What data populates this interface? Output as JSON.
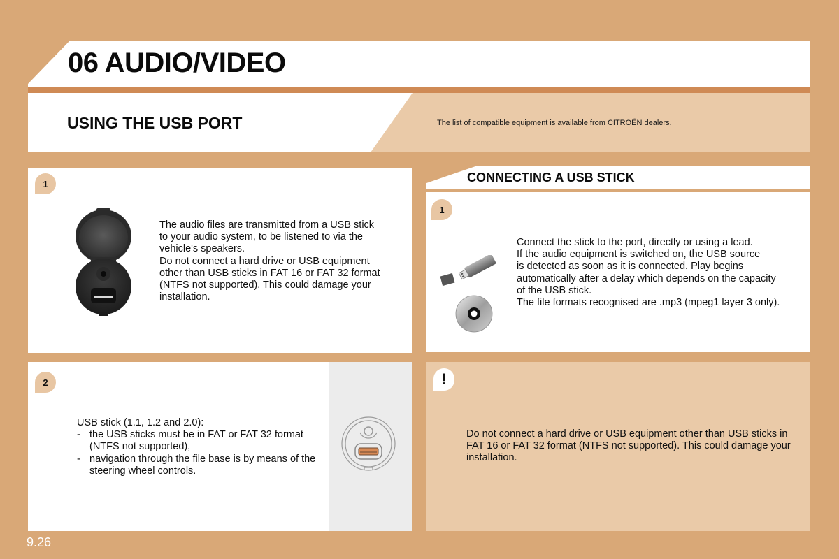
{
  "header": {
    "title": "06 AUDIO/VIDEO",
    "subtitle": "USING THE USB PORT",
    "note": "The list of compatible equipment is available from CITROËN dealers."
  },
  "colors": {
    "background": "#d9a877",
    "accent_rule": "#cf8a55",
    "panel_tint": "#eacaa8",
    "badge": "#e8c6a3"
  },
  "panels": {
    "port_info": {
      "badge": "1",
      "text": "The audio files are transmitted from a USB stick\nto your audio system, to be listened to via the\nvehicle's speakers.\nDo not connect a hard drive or USB equipment\nother than USB sticks in FAT 16 or FAT 32 format\n(NTFS not supported). This could damage your\ninstallation.",
      "illustration": "usb-socket-icon"
    },
    "stick_requirements": {
      "badge": "2",
      "intro": "USB stick (1.1, 1.2 and 2.0):",
      "items": [
        {
          "dash": "-",
          "text": "the USB sticks must be in FAT or FAT 32 format (NTFS not supported),"
        },
        {
          "dash": "-",
          "text": "navigation through the file base is by means of the steering wheel controls."
        }
      ],
      "illustration": "usb-port-outline-icon"
    },
    "connecting": {
      "heading": "CONNECTING A USB STICK",
      "badge": "1",
      "text": "Connect the stick to the port, directly or using a lead.\nIf the audio equipment is switched on, the USB source\nis detected as soon as it is connected. Play begins\nautomatically after a delay which depends on the capacity\nof the USB stick.\nThe file formats recognised are .mp3 (mpeg1 layer 3 only).",
      "illustrations": [
        "usb-stick-icon",
        "cd-icon"
      ]
    },
    "warning": {
      "badge": "!",
      "text": "Do not connect a hard drive or USB equipment other than USB sticks in FAT 16 or FAT 32 format (NTFS not supported). This could damage your installation."
    }
  },
  "footer": {
    "page_number": "9.26"
  }
}
